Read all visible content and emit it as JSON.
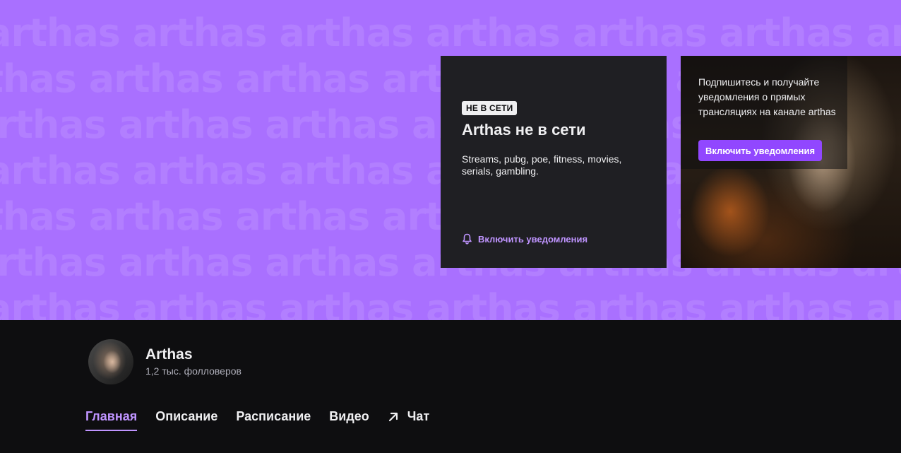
{
  "banner": {
    "bg_word": "arthas",
    "offline_card": {
      "badge": "НЕ В СЕТИ",
      "title": "Arthas не в сети",
      "description": "Streams, pubg, poe, fitness, movies, serials, gambling.",
      "notify_label": "Включить уведомления"
    },
    "promo_card": {
      "text": "Подпишитесь и получайте уведомления о прямых трансляциях на канале arthas",
      "button_label": "Включить уведомления"
    }
  },
  "channel": {
    "name": "Arthas",
    "followers": "1,2 тыс. фолловеров"
  },
  "tabs": [
    {
      "label": "Главная",
      "active": true
    },
    {
      "label": "Описание",
      "active": false
    },
    {
      "label": "Расписание",
      "active": false
    },
    {
      "label": "Видео",
      "active": false
    },
    {
      "label": "Чат",
      "active": false
    }
  ],
  "icons": {
    "notify": "bell-icon",
    "chat": "arrow-up-right-icon"
  },
  "colors": {
    "banner_bg": "#a970ff",
    "accent": "#9147ff",
    "accent_light": "#bf94ff",
    "card_bg": "#1f1f23",
    "page_bg": "#0e0e10"
  }
}
